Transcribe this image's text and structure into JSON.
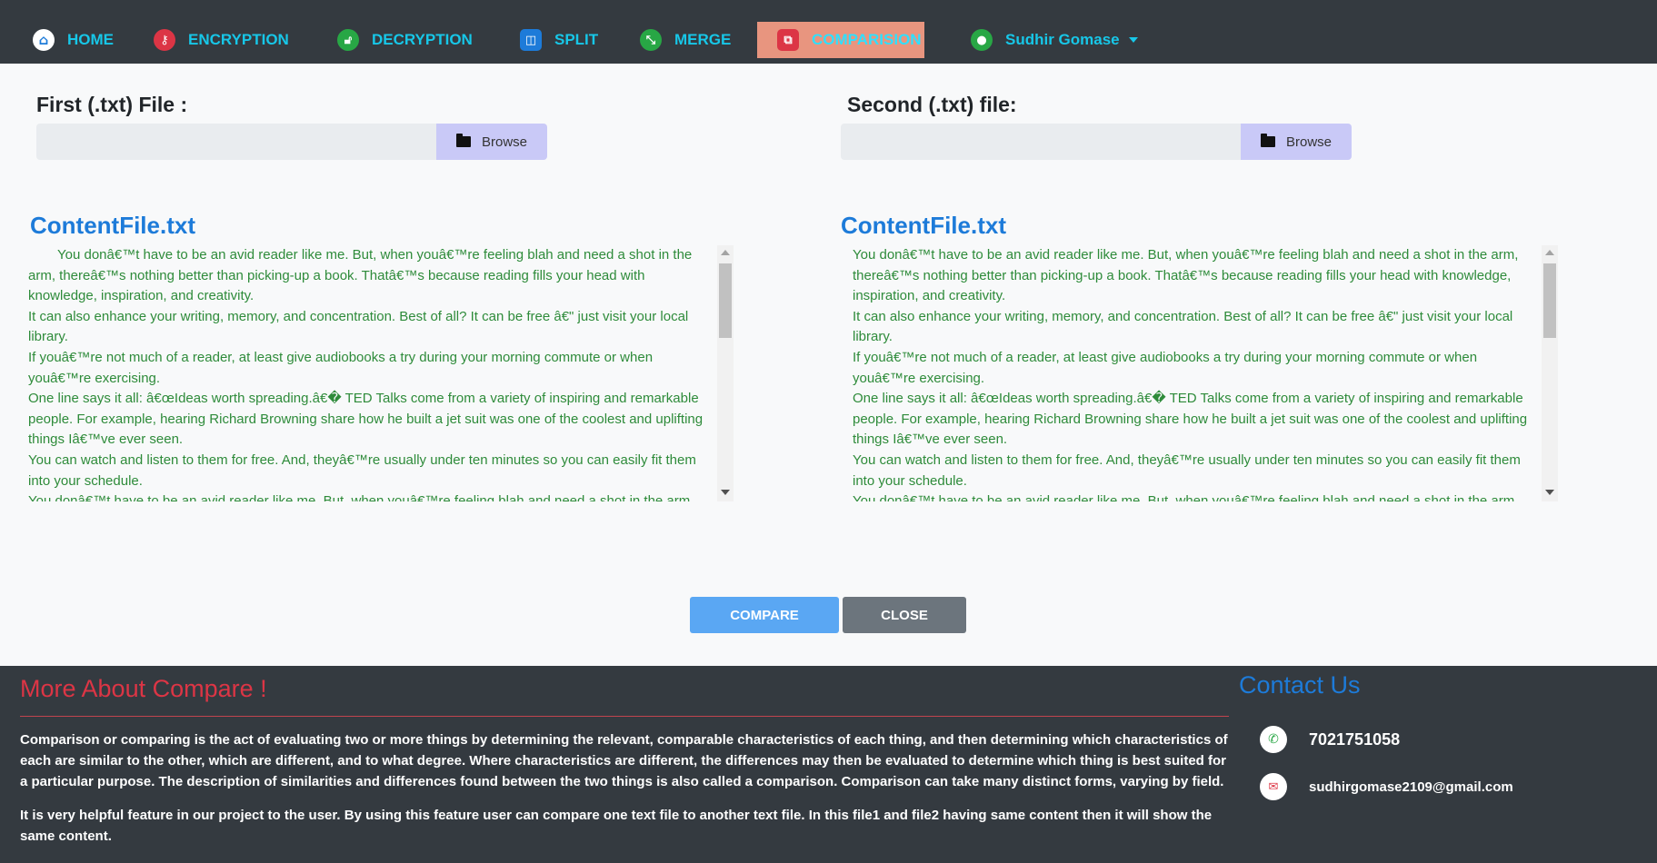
{
  "nav": {
    "items": [
      {
        "label": "HOME",
        "icon": "home-icon"
      },
      {
        "label": "ENCRYPTION",
        "icon": "key-icon"
      },
      {
        "label": "DECRYPTION",
        "icon": "unlock-icon"
      },
      {
        "label": "SPLIT",
        "icon": "split-icon"
      },
      {
        "label": "MERGE",
        "icon": "merge-icon"
      },
      {
        "label": "COMPARISION",
        "icon": "compare-icon",
        "active": true
      }
    ],
    "user": {
      "name": "Sudhir Gomase",
      "icon": "user-icon"
    }
  },
  "first_file": {
    "label": "First (.txt) File :",
    "input_value": "",
    "browse_label": "Browse",
    "content_title": "ContentFile.txt",
    "lines": [
      "You donâ€™t have to be an avid reader like me. But, when youâ€™re feeling blah and need a shot in the arm, thereâ€™s nothing better than picking-up a book. Thatâ€™s because reading fills your head with knowledge, inspiration, and creativity.",
      "It can also enhance your writing, memory, and concentration. Best of all? It can be free â€\" just visit your local library.",
      "If youâ€™re not much of a reader, at least give audiobooks a try during your morning commute or when youâ€™re exercising.",
      "One line says it all: â€œIdeas worth spreading.â€� TED Talks come from a variety of inspiring and remarkable people. For example, hearing Richard Browning share how he built a jet suit was one of the coolest and uplifting things Iâ€™ve ever seen.",
      "You can watch and listen to them for free. And, theyâ€™re usually under ten minutes so you can easily fit them into your schedule.",
      "You donâ€™t have to be an avid reader like me. But, when youâ€™re feeling blah and need a shot in the arm,"
    ]
  },
  "second_file": {
    "label": "Second (.txt) file:",
    "input_value": "",
    "browse_label": "Browse",
    "content_title": "ContentFile.txt",
    "lines": [
      "You donâ€™t have to be an avid reader like me. But, when youâ€™re feeling blah and need a shot in the arm, thereâ€™s nothing better than picking-up a book. Thatâ€™s because reading fills your head with knowledge, inspiration, and creativity.",
      "It can also enhance your writing, memory, and concentration. Best of all? It can be free â€\" just visit your local library.",
      "If youâ€™re not much of a reader, at least give audiobooks a try during your morning commute or when youâ€™re exercising.",
      "One line says it all: â€œIdeas worth spreading.â€� TED Talks come from a variety of inspiring and remarkable people. For example, hearing Richard Browning share how he built a jet suit was one of the coolest and uplifting things Iâ€™ve ever seen.",
      "You can watch and listen to them for free. And, theyâ€™re usually under ten minutes so you can easily fit them into your schedule.",
      "You donâ€™t have to be an avid reader like me. But, when youâ€™re feeling blah and need a shot in the arm,"
    ]
  },
  "actions": {
    "compare_label": "COMPARE",
    "close_label": "CLOSE"
  },
  "footer": {
    "about_title": "More About Compare !",
    "para1": "Comparison or comparing is the act of evaluating two or more things by determining the relevant, comparable characteristics of each thing, and then determining which characteristics of each are similar to the other, which are different, and to what degree. Where characteristics are different, the differences may then be evaluated to determine which thing is best suited for a particular purpose. The description of similarities and differences found between the two things is also called a comparison. Comparison can take many distinct forms, varying by field.",
    "para2": "It is very helpful feature in our project to the user. By using this feature user can compare one text file to another text file. In this file1 and file2 having same content then it will show the same content.",
    "contact_title": "Contact Us",
    "phone": "7021751058",
    "email": "sudhirgomase2109@gmail.com"
  },
  "colors": {
    "navbar_bg": "#343a40",
    "nav_text": "#17c7e8",
    "active_tab_bg": "#e8957f",
    "content_title": "#1d7bd9",
    "content_text": "#2e8b3a",
    "compare_btn": "#5aa7f3",
    "close_btn": "#6c757d",
    "footer_title": "#dc3545"
  }
}
